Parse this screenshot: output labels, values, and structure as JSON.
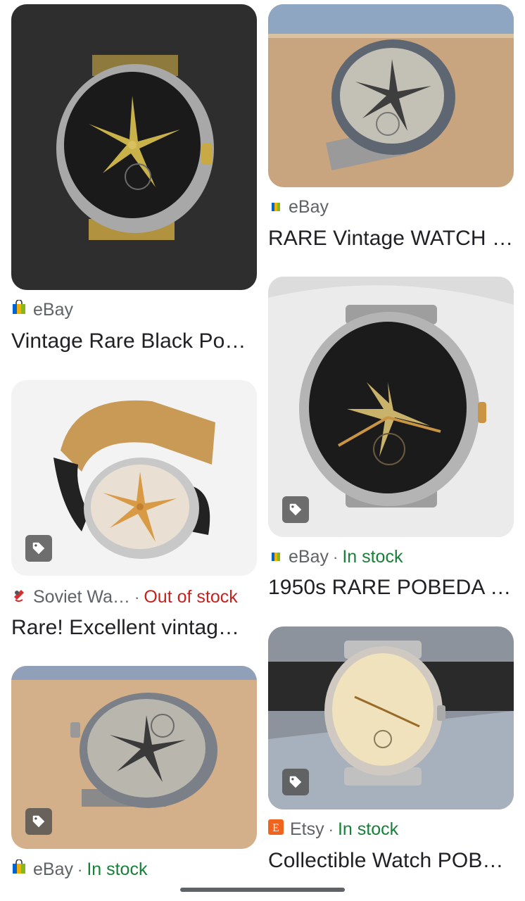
{
  "colors": {
    "in_stock": "#188038",
    "out_of_stock": "#c5221f",
    "source": "#5f6368"
  },
  "results": [
    {
      "source": "eBay",
      "availability": "",
      "title": "Vintage Rare Black Po…",
      "favicon": "ebay-favicon",
      "has_tag": false
    },
    {
      "source": "eBay",
      "availability": "",
      "title": "RARE Vintage WATCH …",
      "favicon": "ebay-favicon",
      "has_tag": false
    },
    {
      "source": "Soviet Wa…",
      "availability": "Out of stock",
      "title": "Rare! Excellent vintag…",
      "favicon": "soviet-watch-favicon",
      "has_tag": true
    },
    {
      "source": "eBay",
      "availability": "In stock",
      "title": "1950s RARE POBEDA …",
      "favicon": "ebay-favicon",
      "has_tag": true
    },
    {
      "source": "eBay",
      "availability": "In stock",
      "title": "",
      "favicon": "ebay-favicon",
      "has_tag": true
    },
    {
      "source": "Etsy",
      "availability": "In stock",
      "title": "Collectible Watch POB…",
      "favicon": "etsy-favicon",
      "has_tag": true
    }
  ],
  "separator": "·"
}
